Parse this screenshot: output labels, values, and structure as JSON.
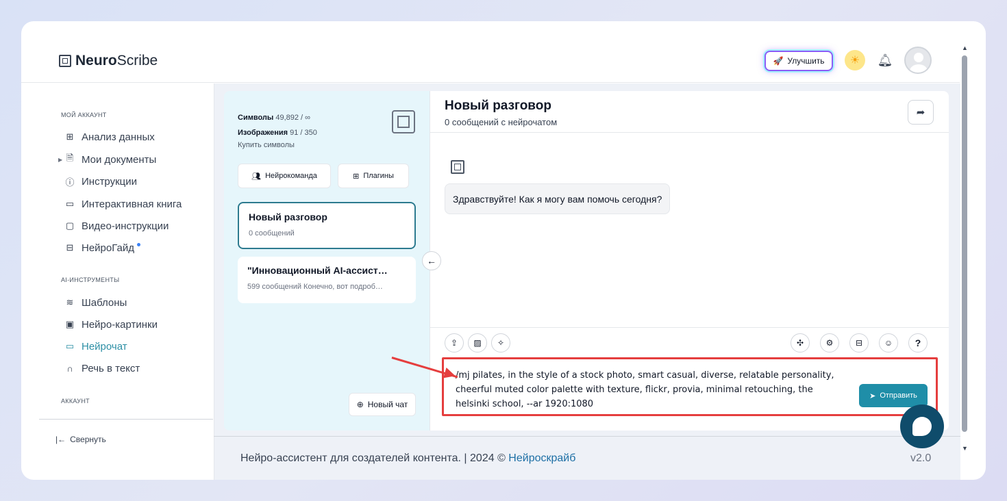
{
  "app": {
    "logo_bold": "Neuro",
    "logo_light": "Scribe"
  },
  "header": {
    "upgrade_label": "Улучшить"
  },
  "sidebar": {
    "section_account": "МОЙ АККАУНТ",
    "items_account": [
      {
        "label": "Анализ данных",
        "icon": "grid-icon"
      },
      {
        "label": "Мои документы",
        "icon": "document-icon"
      },
      {
        "label": "Инструкции",
        "icon": "help-circle-icon"
      },
      {
        "label": "Интерактивная книга",
        "icon": "book-icon"
      },
      {
        "label": "Видео-инструкции",
        "icon": "video-icon"
      },
      {
        "label": "НейроГайд",
        "icon": "layout-icon"
      }
    ],
    "section_tools": "AI-ИНСТРУМЕНТЫ",
    "items_tools": [
      {
        "label": "Шаблоны",
        "icon": "layers-icon"
      },
      {
        "label": "Нейро-картинки",
        "icon": "image-icon"
      },
      {
        "label": "Нейрочат",
        "icon": "chat-icon",
        "active": true
      },
      {
        "label": "Речь в текст",
        "icon": "headphones-icon"
      }
    ],
    "section_acc2": "АККАУНТ",
    "collapse_label": "Свернуть"
  },
  "chatlist": {
    "symbols_label": "Символы",
    "symbols_value": "49,892 / ∞",
    "images_label": "Изображения",
    "images_value": "91 / 350",
    "buy_label": "Купить символы",
    "team_label": "Нейрокоманда",
    "plugins_label": "Плагины",
    "conversations": [
      {
        "title": "Новый разговор",
        "subtitle": "0 сообщений"
      },
      {
        "title": "\"Инновационный AI-ассист…",
        "subtitle": "599 сообщений Конечно, вот подроб…"
      }
    ],
    "new_chat_label": "Новый чат"
  },
  "chat": {
    "title": "Новый разговор",
    "subtitle": "0 сообщений с нейрочатом",
    "greeting": "Здравствуйте! Как я могу вам помочь сегодня?",
    "input_value": "/mj pilates, in the style of a stock photo, smart casual, diverse, relatable personality, cheerful muted color palette with texture, flickr, provia, minimal retouching, the helsinki school, --ar 1920:1080",
    "send_label": "Отправить",
    "help_label": "?"
  },
  "footer": {
    "text": "Нейро-ассистент для создателей контента. | 2024 © ",
    "link": "Нейроскрайб",
    "version": "v2.0"
  },
  "colors": {
    "accent": "#1f8ea8",
    "highlight": "#e53e3e",
    "panel": "#e6f6fb"
  }
}
